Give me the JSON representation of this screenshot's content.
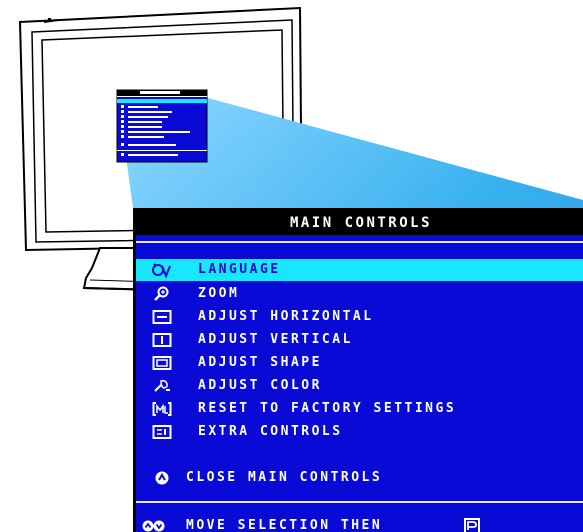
{
  "osd": {
    "title": "MAIN CONTROLS",
    "items": [
      {
        "label": "LANGUAGE",
        "icon": "language-icon",
        "selected": true
      },
      {
        "label": "ZOOM",
        "icon": "zoom-icon",
        "selected": false
      },
      {
        "label": "ADJUST HORIZONTAL",
        "icon": "horizontal-icon",
        "selected": false
      },
      {
        "label": "ADJUST VERTICAL",
        "icon": "vertical-icon",
        "selected": false
      },
      {
        "label": "ADJUST SHAPE",
        "icon": "shape-icon",
        "selected": false
      },
      {
        "label": "ADJUST COLOR",
        "icon": "color-icon",
        "selected": false
      },
      {
        "label": "RESET TO FACTORY SETTINGS",
        "icon": "reset-icon",
        "selected": false
      },
      {
        "label": "EXTRA CONTROLS",
        "icon": "extra-controls-icon",
        "selected": false
      }
    ],
    "close_label": "CLOSE MAIN CONTROLS",
    "hint_label": "MOVE SELECTION THEN"
  },
  "colors": {
    "menu_background": "#0a0ad6",
    "selection": "#19e6ff",
    "title_bar": "#000000",
    "zoom_beam": "#38b6f2"
  }
}
